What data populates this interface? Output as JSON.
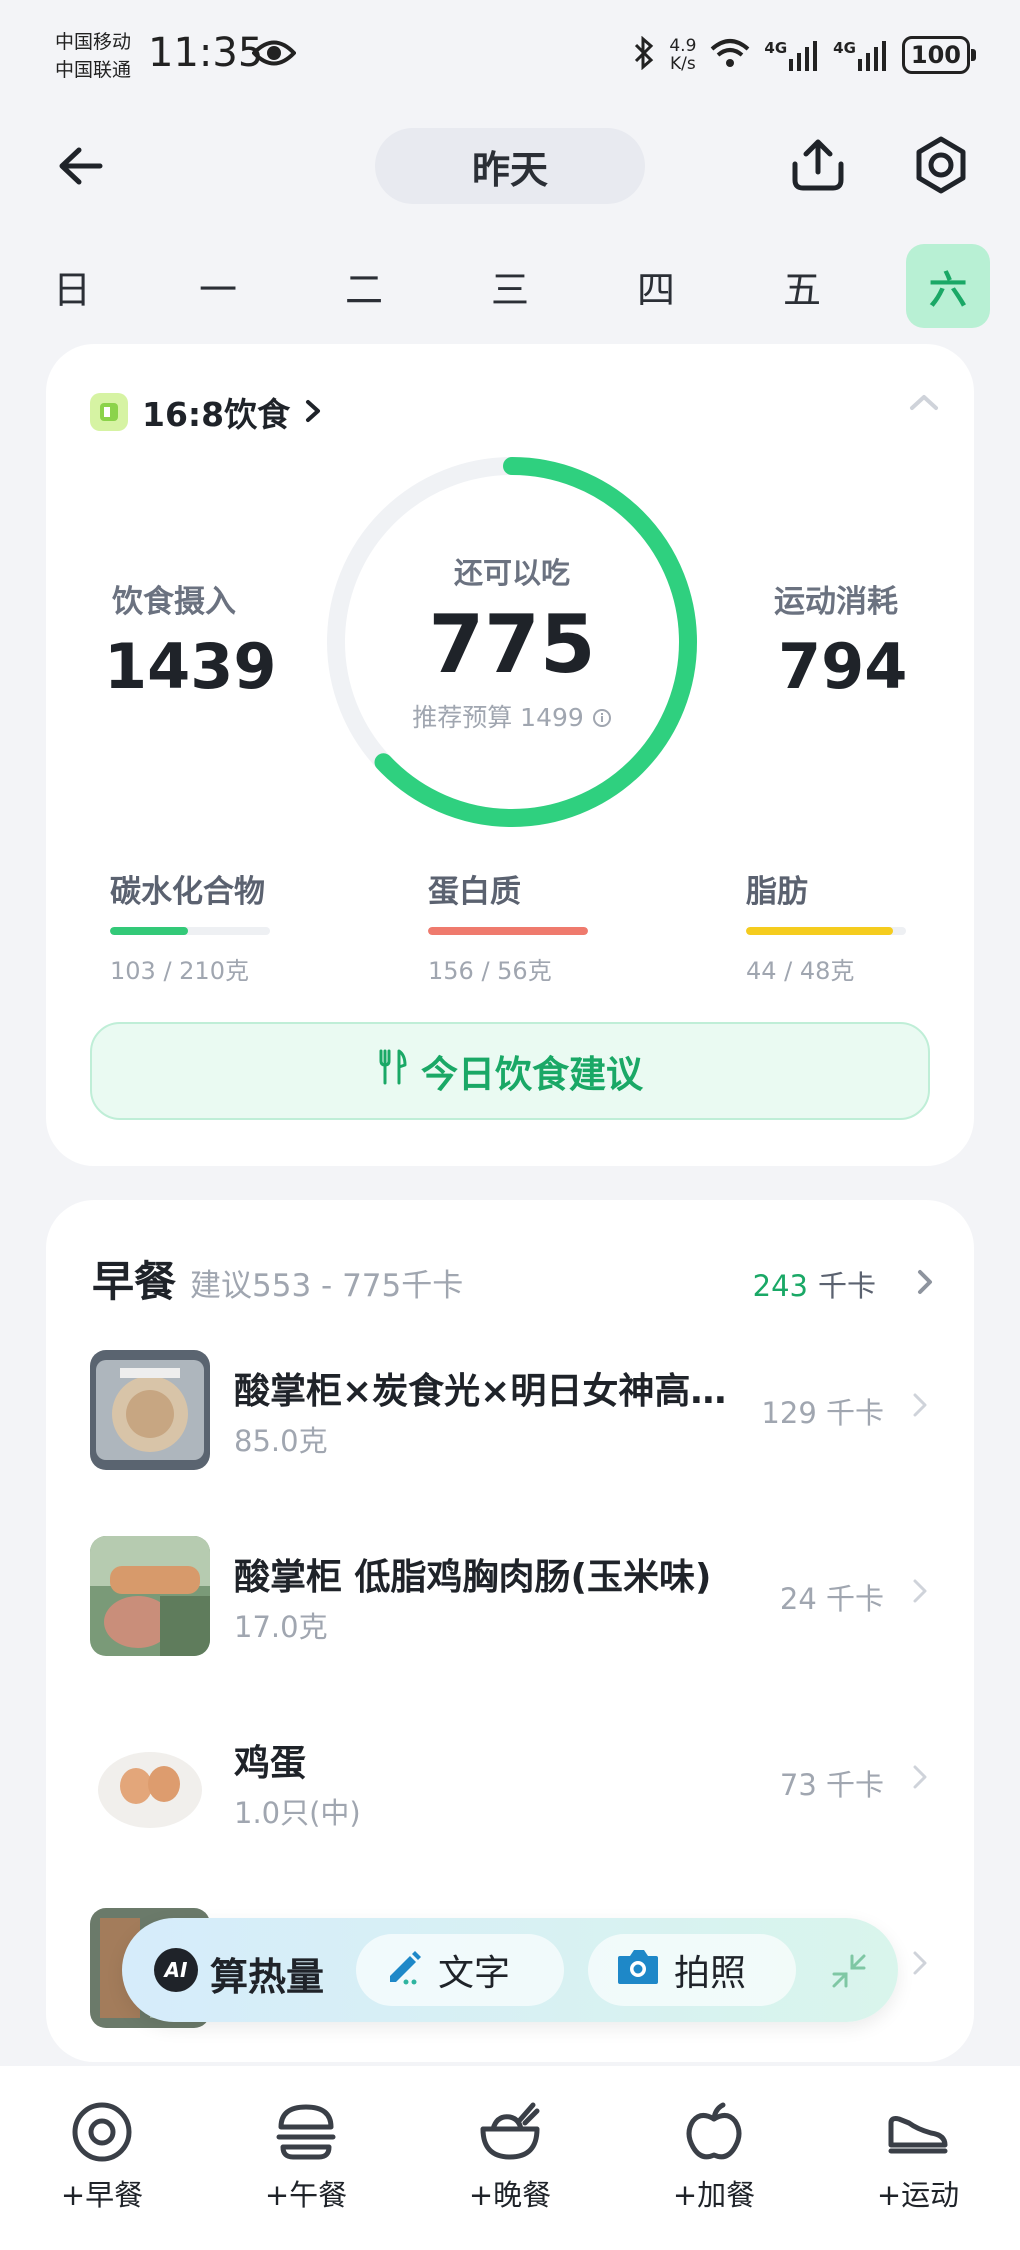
{
  "status_bar": {
    "carrier_1": "中国移动",
    "carrier_2": "中国联通",
    "time": "11:35",
    "net_speed_value": "4.9",
    "net_speed_unit": "K/s",
    "signal_1": "4G",
    "signal_2": "4G",
    "battery": "100"
  },
  "nav": {
    "date_label": "昨天"
  },
  "week_days": [
    "日",
    "一",
    "二",
    "三",
    "四",
    "五",
    "六"
  ],
  "selected_day_index": 6,
  "summary": {
    "fasting_label": "16:8饮食",
    "intake_label": "饮食摄入",
    "intake_value": "1439",
    "exercise_label": "运动消耗",
    "exercise_value": "794",
    "remaining_label": "还可以吃",
    "remaining_value": "775",
    "budget_label": "推荐预算 1499",
    "ring_progress": 0.63,
    "accent_color": "#2fd07f"
  },
  "macros": [
    {
      "label": "碳水化合物",
      "amount": "103 / 210克",
      "fraction": 0.49,
      "color": "#33c978"
    },
    {
      "label": "蛋白质",
      "amount": "156 / 56克",
      "fraction": 1.0,
      "color": "#ef7a6d"
    },
    {
      "label": "脂肪",
      "amount": "44 / 48克",
      "fraction": 0.92,
      "color": "#f5cc1e"
    }
  ],
  "advice_button": "今日饮食建议",
  "breakfast": {
    "title": "早餐",
    "suggestion": "建议553 - 775千卡",
    "total_value": "243",
    "total_unit": "千卡",
    "items": [
      {
        "name": "酸掌柜×炭食光×明日女神高蛋白鸡肉饼",
        "amount": "85.0克",
        "kcal": "129 千卡"
      },
      {
        "name": "酸掌柜 低脂鸡胸肉肠(玉米味)",
        "amount": "17.0克",
        "kcal": "24 千卡"
      },
      {
        "name": "鸡蛋",
        "amount": "1.0只(中)",
        "kcal": "73 千卡"
      }
    ]
  },
  "calc_bar": {
    "ai_badge": "AI",
    "title": "算热量",
    "text_button": "文字",
    "photo_button": "拍照"
  },
  "bottom_tabs": [
    {
      "label": "+早餐",
      "icon": "breakfast-icon"
    },
    {
      "label": "+午餐",
      "icon": "lunch-icon"
    },
    {
      "label": "+晚餐",
      "icon": "dinner-icon"
    },
    {
      "label": "+加餐",
      "icon": "snack-icon"
    },
    {
      "label": "+运动",
      "icon": "exercise-icon"
    }
  ]
}
